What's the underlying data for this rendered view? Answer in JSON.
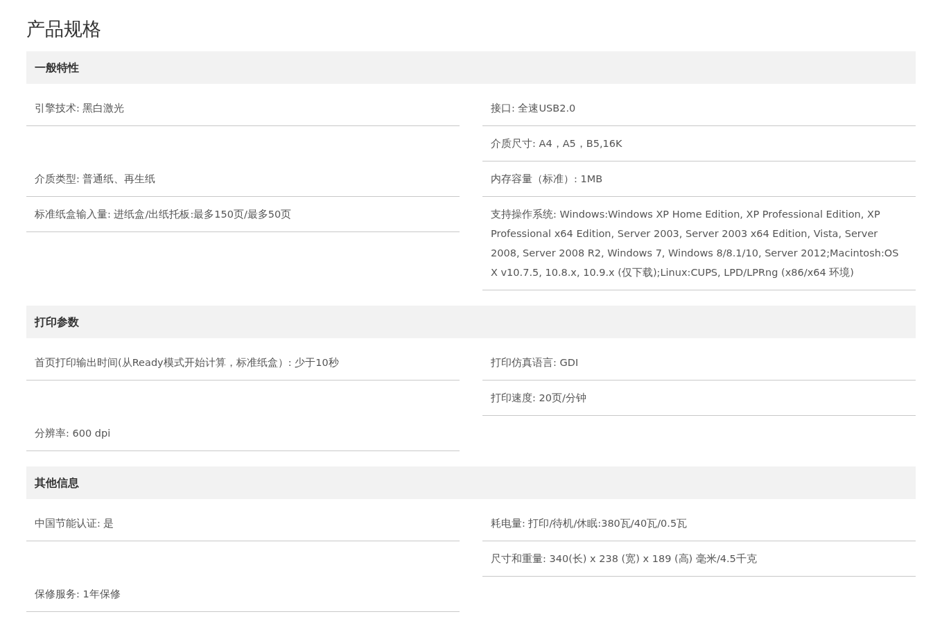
{
  "title": "产品规格",
  "sections": [
    {
      "title": "一般特性",
      "rows": [
        {
          "left": "引擎技术: 黑白激光",
          "right": "接口: 全速USB2.0"
        },
        {
          "right": "介质尺寸: A4，A5，B5,16K"
        },
        {
          "left": "介质类型: 普通纸、再生纸",
          "right": "内存容量（标准）: 1MB"
        },
        {
          "left": "标准纸盒输入量: 进纸盒/出纸托板:最多150页/最多50页",
          "right": "支持操作系统: Windows:Windows XP Home Edition, XP Professional Edition, XP Professional x64 Edition, Server 2003, Server 2003 x64 Edition, Vista, Server 2008, Server 2008 R2, Windows 7, Windows 8/8.1/10, Server 2012;Macintosh:OS X v10.7.5, 10.8.x, 10.9.x (仅下载);Linux:CUPS, LPD/LPRng (x86/x64 环境)"
        }
      ]
    },
    {
      "title": "打印参数",
      "rows": [
        {
          "left": "首页打印输出时间(从Ready模式开始计算，标准纸盒）: 少于10秒",
          "right": "打印仿真语言: GDI"
        },
        {
          "right": "打印速度: 20页/分钟"
        },
        {
          "left": "分辨率: 600 dpi"
        }
      ]
    },
    {
      "title": "其他信息",
      "rows": [
        {
          "left": "中国节能认证: 是",
          "right": "耗电量: 打印/待机/休眠:380瓦/40瓦/0.5瓦"
        },
        {
          "right": "尺寸和重量: 340(长) x 238 (宽) x 189 (高) 毫米/4.5千克"
        },
        {
          "left": "保修服务: 1年保修"
        }
      ]
    }
  ]
}
